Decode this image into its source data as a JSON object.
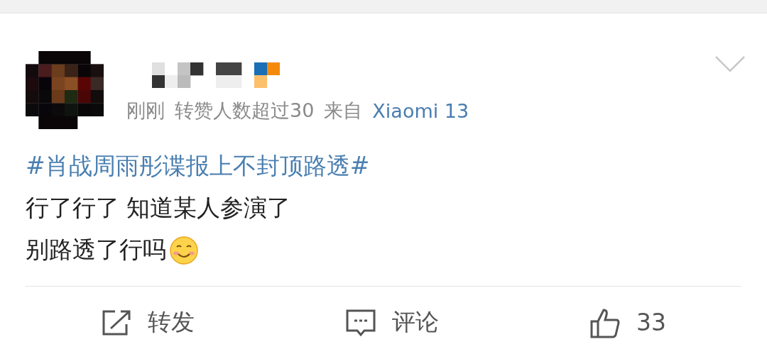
{
  "post": {
    "avatar": {
      "kind": "picture"
    },
    "meta": {
      "time": "刚刚",
      "note": "转赞人数超过30",
      "from_label": "来自",
      "source": "Xiaomi 13"
    },
    "hashtag": "#肖战周雨彤谍报上不封顶路透#",
    "lines": [
      "行了行了 知道某人参演了",
      "别路透了行吗"
    ],
    "actions": [
      {
        "kind": "repost",
        "label": "转发"
      },
      {
        "kind": "comment",
        "label": "评论"
      },
      {
        "kind": "like",
        "label": "33"
      }
    ]
  }
}
